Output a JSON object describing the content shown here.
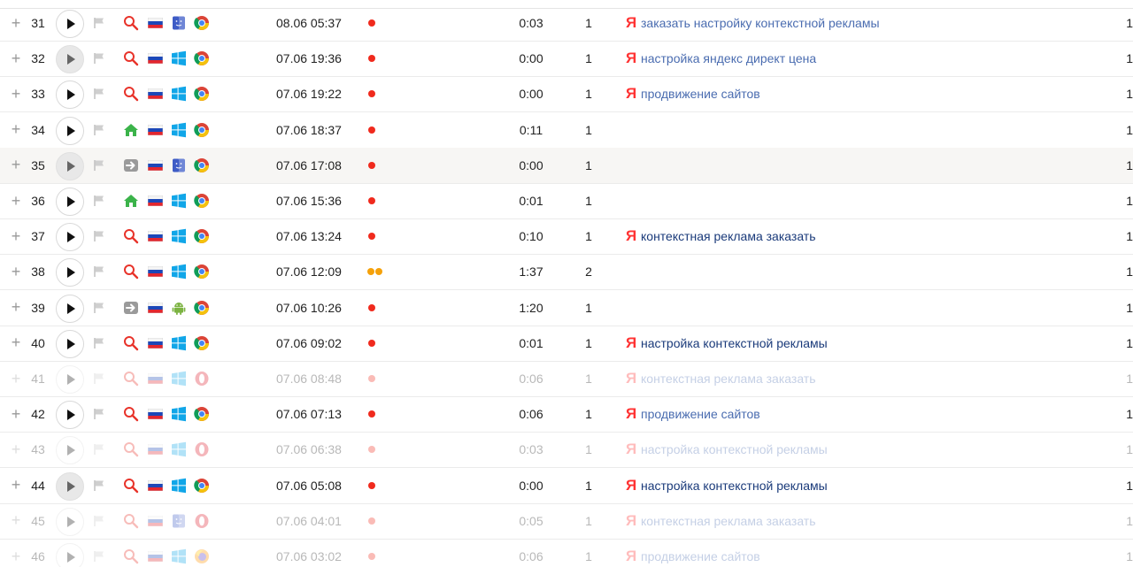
{
  "colors": {
    "yandex_red": "#f33",
    "query_link": "#4a6cb0",
    "visit_dot_red": "#f02a1d",
    "visit_dot_orange": "#f5a10a"
  },
  "rows": [
    {
      "num": "31",
      "play_style": "active",
      "source_icon": "search-icon",
      "country_icon": "russia-flag-icon",
      "os_icon": "macos-icon",
      "browser_icon": "chrome-icon",
      "datetime": "08.06 05:37",
      "visits_dots": "red",
      "duration": "0:03",
      "views": "1",
      "yandex_mark": "Я",
      "query": "заказать настройку контекстной рекламы",
      "last": "1",
      "dim": false,
      "highlight": false
    },
    {
      "num": "32",
      "play_style": "gray",
      "source_icon": "search-icon",
      "country_icon": "russia-flag-icon",
      "os_icon": "windows-icon",
      "browser_icon": "chrome-icon",
      "datetime": "07.06 19:36",
      "visits_dots": "red",
      "duration": "0:00",
      "views": "1",
      "yandex_mark": "Я",
      "query": "настройка яндекс директ цена",
      "last": "1",
      "dim": false,
      "highlight": false
    },
    {
      "num": "33",
      "play_style": "active",
      "source_icon": "search-icon",
      "country_icon": "russia-flag-icon",
      "os_icon": "windows-icon",
      "browser_icon": "chrome-icon",
      "datetime": "07.06 19:22",
      "visits_dots": "red",
      "duration": "0:00",
      "views": "1",
      "yandex_mark": "Я",
      "query": "продвижение сайтов",
      "last": "1",
      "dim": false,
      "highlight": false
    },
    {
      "num": "34",
      "play_style": "active",
      "source_icon": "home-icon",
      "country_icon": "russia-flag-icon",
      "os_icon": "windows-icon",
      "browser_icon": "chrome-icon",
      "datetime": "07.06 18:37",
      "visits_dots": "red",
      "duration": "0:11",
      "views": "1",
      "yandex_mark": "",
      "query": "",
      "last": "1",
      "dim": false,
      "highlight": false
    },
    {
      "num": "35",
      "play_style": "gray",
      "source_icon": "link-arrow-icon",
      "country_icon": "russia-flag-icon",
      "os_icon": "macos-icon",
      "browser_icon": "chrome-icon",
      "datetime": "07.06 17:08",
      "visits_dots": "red",
      "duration": "0:00",
      "views": "1",
      "yandex_mark": "",
      "query": "",
      "last": "1",
      "dim": false,
      "highlight": true
    },
    {
      "num": "36",
      "play_style": "active",
      "source_icon": "home-icon",
      "country_icon": "russia-flag-icon",
      "os_icon": "windows-icon",
      "browser_icon": "chrome-icon",
      "datetime": "07.06 15:36",
      "visits_dots": "red",
      "duration": "0:01",
      "views": "1",
      "yandex_mark": "",
      "query": "",
      "last": "1",
      "dim": false,
      "highlight": false
    },
    {
      "num": "37",
      "play_style": "active",
      "source_icon": "search-icon",
      "country_icon": "russia-flag-icon",
      "os_icon": "windows-icon",
      "browser_icon": "chrome-icon",
      "datetime": "07.06 13:24",
      "visits_dots": "red",
      "duration": "0:10",
      "views": "1",
      "yandex_mark": "Я",
      "query": "контекстная реклама заказать",
      "last": "1",
      "dim": false,
      "highlight": false
    },
    {
      "num": "38",
      "play_style": "active",
      "source_icon": "search-icon",
      "country_icon": "russia-flag-icon",
      "os_icon": "windows-icon",
      "browser_icon": "chrome-icon",
      "datetime": "07.06 12:09",
      "visits_dots": "orange2",
      "duration": "1:37",
      "views": "2",
      "yandex_mark": "",
      "query": "",
      "last": "1",
      "dim": false,
      "highlight": false
    },
    {
      "num": "39",
      "play_style": "active",
      "source_icon": "link-arrow-icon",
      "country_icon": "russia-flag-icon",
      "os_icon": "android-icon",
      "browser_icon": "chrome-icon",
      "datetime": "07.06 10:26",
      "visits_dots": "red",
      "duration": "1:20",
      "views": "1",
      "yandex_mark": "",
      "query": "",
      "last": "1",
      "dim": false,
      "highlight": false
    },
    {
      "num": "40",
      "play_style": "active",
      "source_icon": "search-icon",
      "country_icon": "russia-flag-icon",
      "os_icon": "windows-icon",
      "browser_icon": "chrome-icon",
      "datetime": "07.06 09:02",
      "visits_dots": "red",
      "duration": "0:01",
      "views": "1",
      "yandex_mark": "Я",
      "query": "настройка контекстной рекламы",
      "last": "1",
      "dim": false,
      "highlight": false
    },
    {
      "num": "41",
      "play_style": "active",
      "source_icon": "search-icon",
      "country_icon": "russia-flag-icon",
      "os_icon": "windows-icon",
      "browser_icon": "opera-icon",
      "datetime": "07.06 08:48",
      "visits_dots": "red",
      "duration": "0:06",
      "views": "1",
      "yandex_mark": "Я",
      "query": "контекстная реклама заказать",
      "last": "1",
      "dim": true,
      "highlight": false
    },
    {
      "num": "42",
      "play_style": "active",
      "source_icon": "search-icon",
      "country_icon": "russia-flag-icon",
      "os_icon": "windows-icon",
      "browser_icon": "chrome-icon",
      "datetime": "07.06 07:13",
      "visits_dots": "red",
      "duration": "0:06",
      "views": "1",
      "yandex_mark": "Я",
      "query": "продвижение сайтов",
      "last": "1",
      "dim": false,
      "highlight": false
    },
    {
      "num": "43",
      "play_style": "active",
      "source_icon": "search-icon",
      "country_icon": "russia-flag-icon",
      "os_icon": "windows-icon",
      "browser_icon": "opera-icon",
      "datetime": "07.06 06:38",
      "visits_dots": "red",
      "duration": "0:03",
      "views": "1",
      "yandex_mark": "Я",
      "query": "настройка контекстной рекламы",
      "last": "1",
      "dim": true,
      "highlight": false
    },
    {
      "num": "44",
      "play_style": "gray",
      "source_icon": "search-icon",
      "country_icon": "russia-flag-icon",
      "os_icon": "windows-icon",
      "browser_icon": "chrome-icon",
      "datetime": "07.06 05:08",
      "visits_dots": "red",
      "duration": "0:00",
      "views": "1",
      "yandex_mark": "Я",
      "query": "настройка контекстной рекламы",
      "last": "1",
      "dim": false,
      "highlight": false
    },
    {
      "num": "45",
      "play_style": "active",
      "source_icon": "search-icon",
      "country_icon": "russia-flag-icon",
      "os_icon": "macos-icon",
      "browser_icon": "opera-icon",
      "datetime": "07.06 04:01",
      "visits_dots": "red",
      "duration": "0:05",
      "views": "1",
      "yandex_mark": "Я",
      "query": "контекстная реклама заказать",
      "last": "1",
      "dim": true,
      "highlight": false
    },
    {
      "num": "46",
      "play_style": "active",
      "source_icon": "search-icon",
      "country_icon": "russia-flag-icon",
      "os_icon": "windows-icon",
      "browser_icon": "firefox-icon",
      "datetime": "07.06 03:02",
      "visits_dots": "red",
      "duration": "0:06",
      "views": "1",
      "yandex_mark": "Я",
      "query": "продвижение сайтов",
      "last": "1",
      "dim": true,
      "highlight": false
    }
  ]
}
